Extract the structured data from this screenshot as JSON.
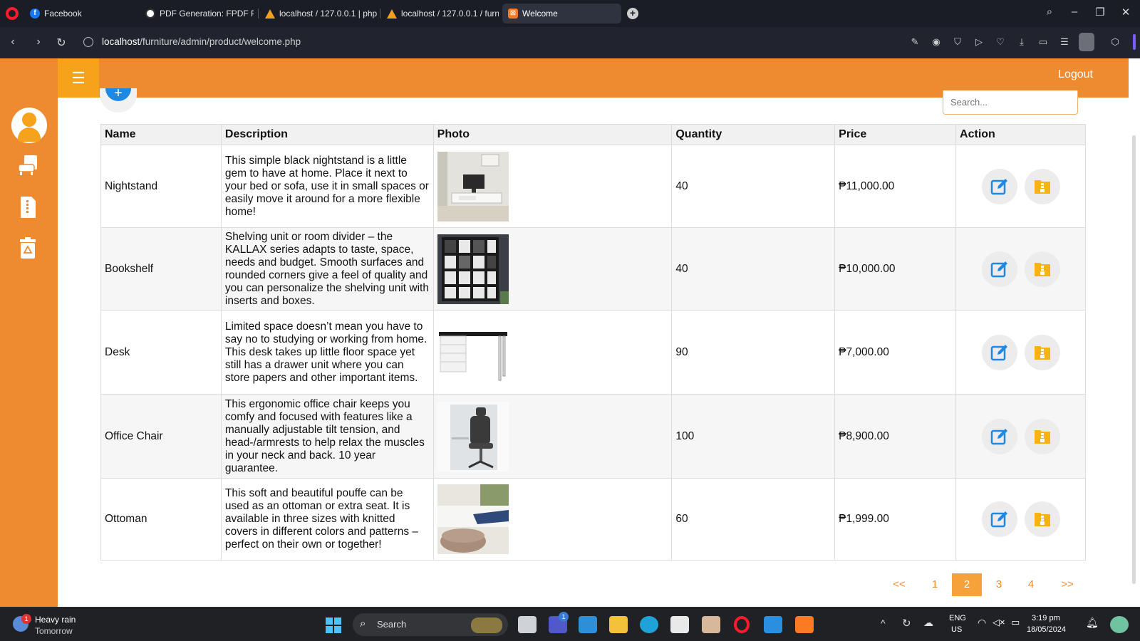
{
  "browser": {
    "tabs": [
      {
        "label": "Facebook",
        "favicon": "facebook-icon"
      },
      {
        "label": "PDF Generation: FPDF PHP",
        "favicon": "chatgpt-icon"
      },
      {
        "label": "localhost / 127.0.0.1 | php",
        "favicon": "phpmyadmin-icon"
      },
      {
        "label": "localhost / 127.0.0.1 / furn",
        "favicon": "phpmyadmin-icon"
      },
      {
        "label": "Welcome",
        "favicon": "xampp-icon",
        "active": true
      }
    ],
    "url_host": "localhost",
    "url_path": "/furniture/admin/product/welcome.php"
  },
  "app": {
    "logout_label": "Logout",
    "search_placeholder": "Search...",
    "add_label": "+",
    "columns": [
      "Name",
      "Description",
      "Photo",
      "Quantity",
      "Price",
      "Action"
    ],
    "rows": [
      {
        "name": "Nightstand",
        "description": "This simple black nightstand is a little gem to have at home. Place it next to your bed or sofa, use it in small spaces or easily move it around for a more flexible home!",
        "quantity": "40",
        "price": "₱11,000.00"
      },
      {
        "name": "Bookshelf",
        "description": "Shelving unit or room divider – the KALLAX series adapts to taste, space, needs and budget. Smooth surfaces and rounded corners give a feel of quality and you can personalize the shelving unit with inserts and boxes.",
        "quantity": "40",
        "price": "₱10,000.00"
      },
      {
        "name": "Desk",
        "description": "Limited space doesn’t mean you have to say no to studying or working from home. This desk takes up little floor space yet still has a drawer unit where you can store papers and other important items.",
        "quantity": "90",
        "price": "₱7,000.00"
      },
      {
        "name": "Office Chair",
        "description": "This ergonomic office chair keeps you comfy and focused with features like a manually adjustable tilt tension, and head-/armrests to help relax the muscles in your neck and back. 10 year guarantee.",
        "quantity": "100",
        "price": "₱8,900.00"
      },
      {
        "name": "Ottoman",
        "description": "This soft and beautiful pouffe can be used as an ottoman or extra seat. It is available in three sizes with knitted covers in different colors and patterns – perfect on their own or together!",
        "quantity": "60",
        "price": "₱1,999.00"
      }
    ],
    "pagination": [
      "<<",
      "1",
      "2",
      "3",
      "4",
      ">>"
    ],
    "current_page": "2",
    "colors": {
      "accent": "#ee8a30",
      "accent_light": "#f6a21a",
      "edit": "#1e88e5",
      "archive": "#f6b312"
    }
  },
  "taskbar": {
    "weather_title": "Heavy rain",
    "weather_sub": "Tomorrow",
    "weather_badge": "1",
    "search_label": "Search",
    "teams_badge": "1",
    "lang": "ENG",
    "region": "US",
    "time": "3:19 pm",
    "date": "18/05/2024"
  }
}
